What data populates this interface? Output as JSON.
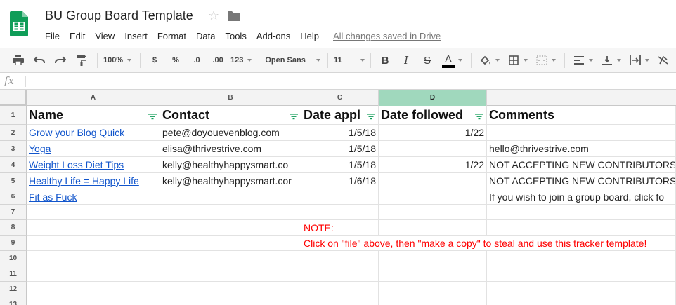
{
  "app": {
    "doc_title": "BU Group Board Template",
    "save_status": "All changes saved in Drive",
    "colors": {
      "brand": "#0f9d58",
      "link": "#1155cc",
      "note": "#ff0000",
      "selected_col": "#a0d8bd"
    }
  },
  "menu": [
    "File",
    "Edit",
    "View",
    "Insert",
    "Format",
    "Data",
    "Tools",
    "Add-ons",
    "Help"
  ],
  "toolbar": {
    "zoom": "100%",
    "currency": "$",
    "percent": "%",
    "decrease_decimal": ".0",
    "increase_decimal": ".00",
    "more_formats": "123",
    "font": "Open Sans",
    "font_size": "11",
    "bold": "B",
    "italic": "I",
    "strike": "S",
    "text_color": "A",
    "icons": [
      "print-icon",
      "undo-icon",
      "redo-icon",
      "paint-format-icon",
      "fill-color-icon",
      "borders-icon",
      "merge-icon",
      "align-left-icon",
      "valign-bottom-icon",
      "text-wrap-icon",
      "text-rotate-icon"
    ]
  },
  "formula_bar": {
    "label": "fx",
    "value": ""
  },
  "sheet": {
    "columns": [
      "A",
      "B",
      "C",
      "D"
    ],
    "selected_column": "D",
    "rows": [
      "1",
      "2",
      "3",
      "4",
      "5",
      "6",
      "7",
      "8",
      "9",
      "10",
      "11",
      "12",
      "13"
    ],
    "header": {
      "name": "Name",
      "contact": "Contact",
      "date_applied": "Date appl",
      "date_followed": "Date followed",
      "comments": "Comments"
    },
    "data": [
      {
        "name": "Grow your Blog Quick",
        "contact": "pete@doyouevenblog.com",
        "date_applied": "1/5/18",
        "date_followed": "1/22",
        "comments": ""
      },
      {
        "name": "Yoga",
        "contact": "elisa@thrivestrive.com",
        "date_applied": "1/5/18",
        "date_followed": "",
        "comments": "hello@thrivestrive.com"
      },
      {
        "name": "Weight Loss Diet Tips",
        "contact": "kelly@healthyhappysmart.co",
        "date_applied": "1/5/18",
        "date_followed": "1/22",
        "comments": "NOT ACCEPTING NEW CONTRIBUTORS."
      },
      {
        "name": "Healthy Life = Happy Life",
        "contact": "kelly@healthyhappysmart.cor",
        "date_applied": "1/6/18",
        "date_followed": "",
        "comments": "NOT ACCEPTING NEW CONTRIBUTORS."
      },
      {
        "name": "Fit as Fuck",
        "contact": "",
        "date_applied": "",
        "date_followed": "",
        "comments": "If you wish to join a group board, click fo"
      }
    ],
    "note_label": "NOTE:",
    "note_text": "Click on \"file\" above, then \"make a copy\" to steal and use this tracker template!"
  }
}
